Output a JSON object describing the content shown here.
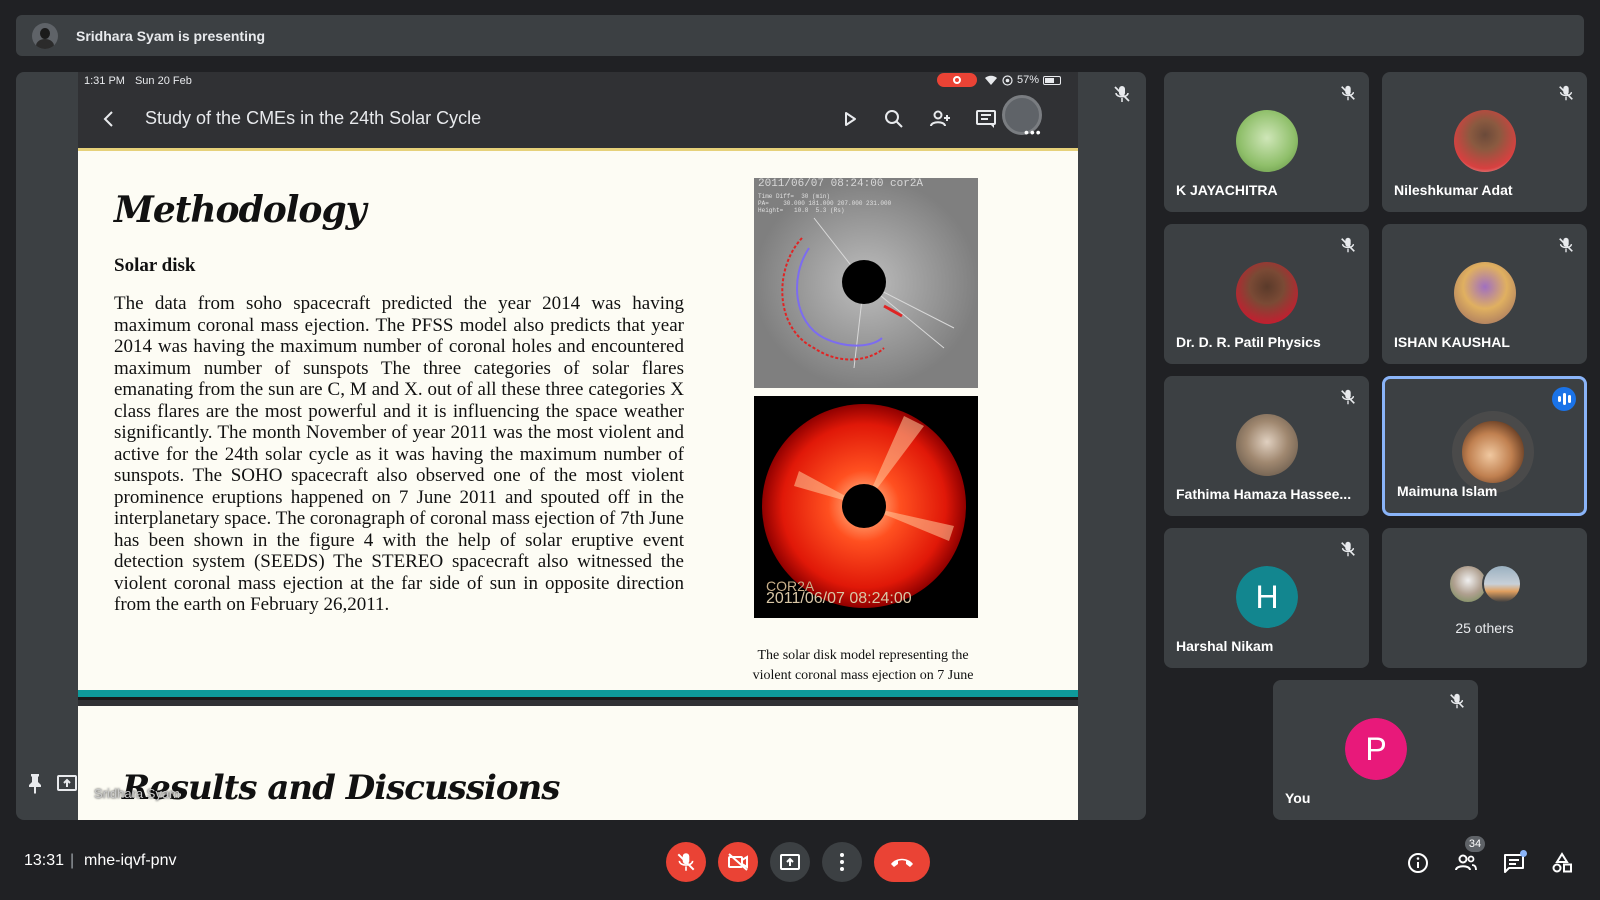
{
  "banner": {
    "text": "Sridhara Syam is presenting"
  },
  "tablet": {
    "status_time": "1:31 PM",
    "status_date": "Sun 20 Feb",
    "battery": "57%",
    "doc_title": "Study of the CMEs in the 24th Solar Cycle"
  },
  "slide": {
    "heading": "Methodology",
    "subheading": "Solar disk",
    "body": "The data from soho spacecraft predicted the year 2014 was having maximum coronal mass ejection. The PFSS model also predicts that year 2014 was having the maximum number of coronal holes and encountered maximum number of sunspots The three categories of solar flares emanating from the sun are C, M and X. out of all these three categories X class flares are the most powerful and it is influencing the space weather significantly. The month November of year 2011 was the most violent and active for the 24th solar cycle as it was having the maximum number of sunspots. The SOHO spacecraft also observed one of the most violent prominence eruptions happened on 7 June 2011 and spouted off in the interplanetary space. The coronagraph of coronal mass ejection of 7th June has been shown in the figure 4 with the help of solar eruptive event detection system (SEEDS) The STEREO spacecraft also witnessed the violent coronal mass ejection at the far side of sun in opposite direction from the earth on February 26,2011.",
    "fig1_header": "2011/06/07 08:24:00 cor2A",
    "fig1_sub": "Time Diff=  30 (min)\nPA=    30.000 181.000 207.000 231.000\nHeight=   10.8  5.3 (Rs)",
    "fig2_label_a": "COR2A",
    "fig2_label_b": "2011/06/07 08:24:00",
    "caption": "The solar disk model representing the violent coronal mass ejection on 7 June 2011",
    "next_heading": "Results and Discussions"
  },
  "presenter_tile_name": "Sridhara Syam",
  "participants": [
    {
      "name": "K JAYACHITRA",
      "muted": true
    },
    {
      "name": "Nileshkumar Adat",
      "muted": true
    },
    {
      "name": "Dr. D. R. Patil Physics",
      "muted": true
    },
    {
      "name": "ISHAN KAUSHAL",
      "muted": true
    },
    {
      "name": "Fathima Hamaza Hassee...",
      "muted": true
    },
    {
      "name": "Maimuna Islam",
      "muted": false,
      "speaking": true
    },
    {
      "name": "Harshal Nikam",
      "muted": true,
      "initial": "H",
      "color": "#12868f"
    },
    {
      "name": "25 others"
    },
    {
      "name": "You",
      "muted": true,
      "initial": "P",
      "color": "#e8197a"
    }
  ],
  "bottom": {
    "clock": "13:31",
    "separator": "|",
    "meeting_code": "mhe-iqvf-pnv",
    "participant_count": "34"
  },
  "colors": {
    "background": "#202124",
    "tile": "#3c4043",
    "red": "#ea4335",
    "active_border": "#8ab4f8",
    "slide_bg": "#fdfcf4",
    "teal": "#0e9a9a"
  },
  "icons": [
    "pin-icon",
    "present-icon",
    "mic-off-icon",
    "back-icon",
    "play-icon",
    "search-icon",
    "add-person-icon",
    "comment-icon",
    "camera-off-icon",
    "present-now-icon",
    "more-icon",
    "end-call-icon",
    "info-icon",
    "people-icon",
    "chat-icon",
    "activities-icon"
  ]
}
